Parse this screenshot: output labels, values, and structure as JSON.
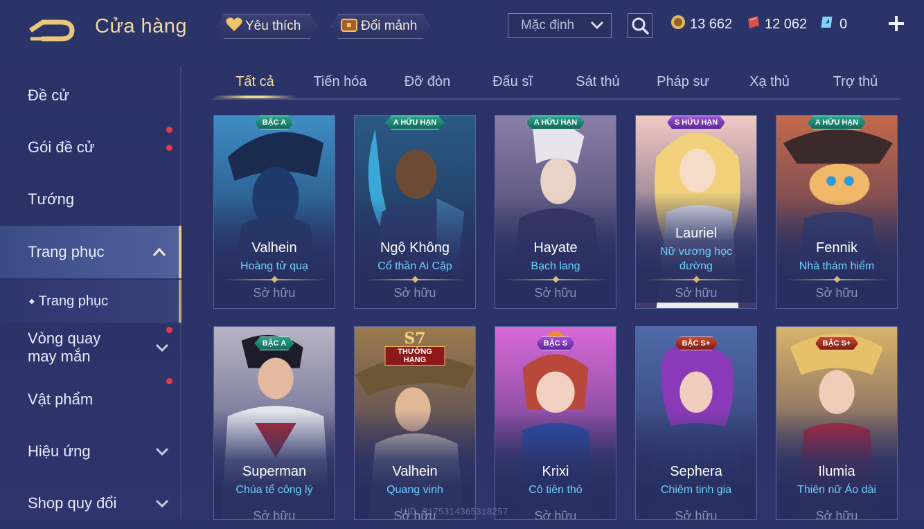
{
  "header": {
    "title": "Cửa hàng",
    "favorites_label": "Yêu thích",
    "exchange_label": "Đổi mảnh",
    "sort_selected": "Mặc định",
    "currencies": [
      {
        "icon": "gold-coin-icon",
        "amount": "13 662"
      },
      {
        "icon": "red-voucher-icon",
        "amount": "12 062"
      },
      {
        "icon": "blue-ticket-icon",
        "amount": "0"
      }
    ]
  },
  "sidebar": {
    "items": [
      {
        "label": "Đề cử",
        "dot": false
      },
      {
        "label": "Gói đề cử",
        "dot": true
      },
      {
        "label": "Tướng",
        "dot": false
      },
      {
        "label": "Trang phục",
        "dot": false
      },
      {
        "label": "Trang phục",
        "dot": false
      },
      {
        "label": "Vòng quay may mắn",
        "dot": true
      },
      {
        "label": "Vật phẩm",
        "dot": true
      },
      {
        "label": "Hiệu ứng",
        "dot": false
      },
      {
        "label": "Shop quy đổi",
        "dot": false
      }
    ]
  },
  "tabs": [
    "Tất cả",
    "Tiến hóa",
    "Đỡ đòn",
    "Đấu sĩ",
    "Sát thủ",
    "Pháp sư",
    "Xạ thủ",
    "Trợ thủ"
  ],
  "cards": [
    {
      "hero": "Valhein",
      "skin": "Hoàng tử quạ",
      "status": "Sở hữu",
      "badge": "BẬC A",
      "badge_type": "teal"
    },
    {
      "hero": "Ngộ Không",
      "skin": "Cổ thần Ai Cập",
      "status": "Sở hữu",
      "badge": "A HỮU HẠN",
      "badge_type": "teal"
    },
    {
      "hero": "Hayate",
      "skin": "Bạch lang",
      "status": "Sở hữu",
      "badge": "A HỮU HẠN",
      "badge_type": "teal"
    },
    {
      "hero": "Lauriel",
      "skin": "Nữ vương học đường",
      "status": "Sở hữu",
      "badge": "S HỮU HẠN",
      "badge_type": "purple"
    },
    {
      "hero": "Fennik",
      "skin": "Nhà thám hiểm",
      "status": "Sở hữu",
      "badge": "A HỮU HẠN",
      "badge_type": "teal"
    },
    {
      "hero": "Superman",
      "skin": "Chúa tể công lý",
      "status": "Sở hữu",
      "badge": "BẬC A",
      "badge_type": "teal"
    },
    {
      "hero": "Valhein",
      "skin": "Quang vinh",
      "status": "Sở hữu",
      "badge": "",
      "season_big": "S7",
      "season_small": "THƯỞNG HẠNG"
    },
    {
      "hero": "Krixi",
      "skin": "Cô tiên thỏ",
      "status": "Sở hữu",
      "badge": "BẬC S",
      "badge_type": "purple"
    },
    {
      "hero": "Sephera",
      "skin": "Chiêm tinh gia",
      "status": "Sở hữu",
      "badge": "BẬC S+",
      "badge_type": "red"
    },
    {
      "hero": "Ilumia",
      "skin": "Thiên nữ Áo dài",
      "status": "Sở hữu",
      "badge": "BẬC S+",
      "badge_type": "red"
    }
  ],
  "footer": {
    "uid_text": "UID: 2175314365318257"
  },
  "colors": {
    "accent_gold": "#f3d88f",
    "skin_name": "#6fd0ff",
    "notify_dot": "#e8394a"
  }
}
